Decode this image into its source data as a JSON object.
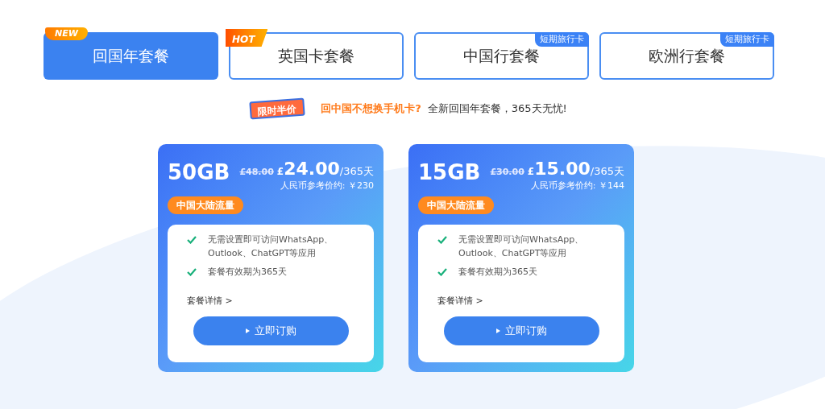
{
  "tabs": [
    {
      "label": "回国年套餐",
      "selected": true,
      "badge": {
        "kind": "new",
        "text": "NEW"
      }
    },
    {
      "label": "英国卡套餐",
      "selected": false,
      "badge": {
        "kind": "hot",
        "text": "HOT"
      }
    },
    {
      "label": "中国行套餐",
      "selected": false,
      "badge": {
        "kind": "tag",
        "text": "短期旅行卡"
      }
    },
    {
      "label": "欧洲行套餐",
      "selected": false,
      "badge": {
        "kind": "tag",
        "text": "短期旅行卡"
      }
    }
  ],
  "promo": {
    "ribbon": "限时半价",
    "highlight": "回中国不想换手机卡?",
    "text": "全新回国年套餐，365天无忧!"
  },
  "plans": [
    {
      "data": "50GB",
      "old_price": "£48.00",
      "currency": "£",
      "price": "24.00",
      "period": "/365天",
      "rmb_ref": "人民币参考价约: ￥230",
      "tag": "中国大陆流量",
      "features": [
        "无需设置即可访问WhatsApp、Outlook、ChatGPT等应用",
        "套餐有效期为365天"
      ],
      "details_link": "套餐详情 >",
      "button": "立即订购"
    },
    {
      "data": "15GB",
      "old_price": "£30.00",
      "currency": "£",
      "price": "15.00",
      "period": "/365天",
      "rmb_ref": "人民币参考价约: ￥144",
      "tag": "中国大陆流量",
      "features": [
        "无需设置即可访问WhatsApp、Outlook、ChatGPT等应用",
        "套餐有效期为365天"
      ],
      "details_link": "套餐详情 >",
      "button": "立即订购"
    }
  ]
}
